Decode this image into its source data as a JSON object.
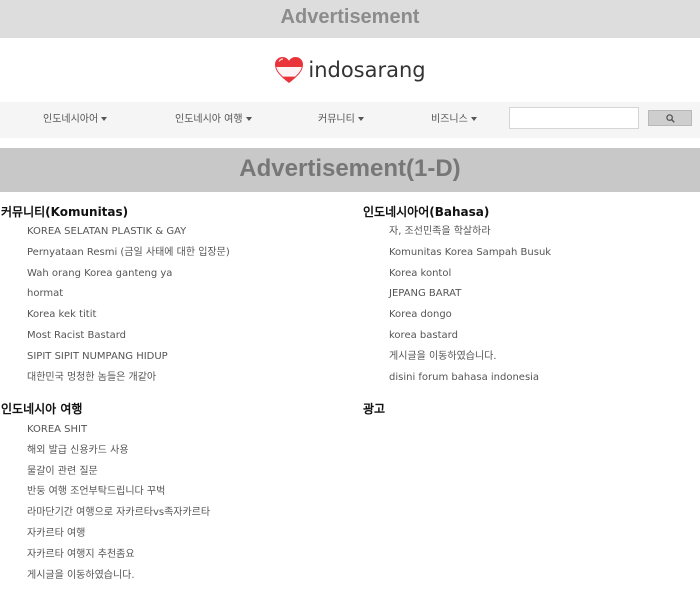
{
  "ads": {
    "top": "Advertisement",
    "mid": "Advertisement(1-D)"
  },
  "logo": {
    "brand": "indosarang"
  },
  "nav": {
    "items": [
      "인도네시아어",
      "인도네시아 여행",
      "커뮤니티",
      "비즈니스"
    ],
    "search_value": ""
  },
  "sections": {
    "komunitas": {
      "title": "커뮤니티(Komunitas)",
      "items": [
        "KOREA SELATAN PLASTIK & GAY",
        "Pernyataan Resmi (금일 사태에 대한 입장문)",
        "Wah orang Korea ganteng ya",
        "hormat",
        "Korea kek titit",
        "Most Racist Bastard",
        "SIPIT SIPIT NUMPANG HIDUP",
        "대한민국 멍청한 놈들은 개같아"
      ]
    },
    "bahasa": {
      "title": "인도네시아어(Bahasa)",
      "items": [
        "자, 조선민족을 학살하라",
        "Komunitas Korea Sampah Busuk",
        "Korea kontol",
        "JEPANG BARAT",
        "Korea dongo",
        "korea bastard",
        "게시글을 이동하였습니다.",
        "disini forum bahasa indonesia"
      ]
    },
    "travel": {
      "title": "인도네시아 여행",
      "items": [
        "KOREA SHIT",
        "해외 발급 신용카드 사용",
        "물갈이 관련 질문",
        "반둥 여행 조언부탁드립니다 꾸벅",
        "라마단기간 여행으로 자카르타vs족자카르타",
        "자카르타 여행",
        "자카르타 여행지 추천좀요",
        "게시글을 이동하였습니다."
      ]
    },
    "ad": {
      "title": "광고"
    }
  }
}
